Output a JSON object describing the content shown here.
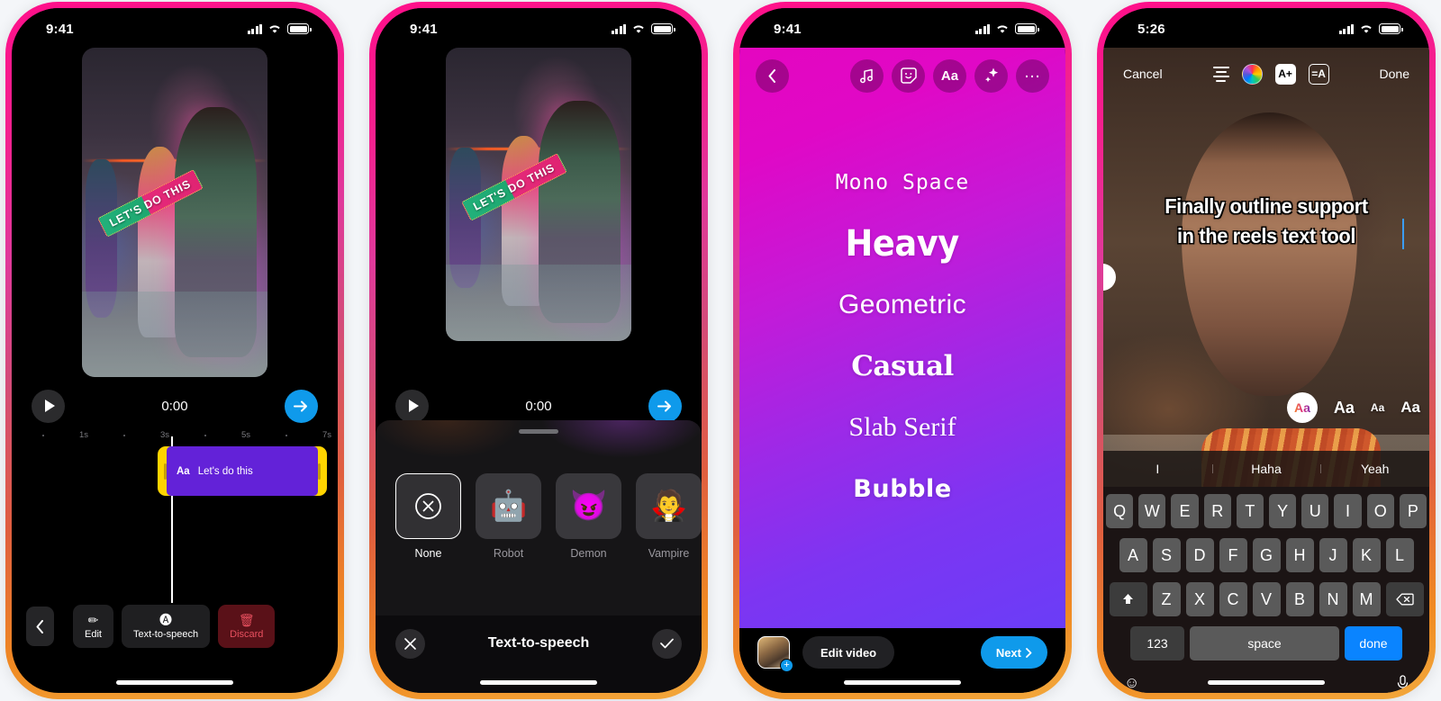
{
  "phone1": {
    "status": {
      "time": "9:41",
      "signal": "cellular-bars-icon",
      "wifi": "wifi-icon",
      "battery": "battery-full-icon"
    },
    "video": {
      "sticker_text": "LET'S DO THIS"
    },
    "transport": {
      "play": "play-icon",
      "time": "0:00",
      "next": "arrow-right-icon"
    },
    "ruler": {
      "ticks": [
        "1s",
        "3s",
        "5s",
        "7s"
      ]
    },
    "clip": {
      "icon_label": "Aa",
      "label": "Let's do this"
    },
    "bottom": {
      "back": "chevron-left-icon",
      "buttons": [
        {
          "name": "edit",
          "icon": "pencil-icon",
          "label": "Edit"
        },
        {
          "name": "text-to-speech",
          "icon": "speech-bubble-a-icon",
          "label": "Text-to-speech"
        },
        {
          "name": "discard",
          "icon": "trash-icon",
          "label": "Discard"
        }
      ]
    }
  },
  "phone2": {
    "status": {
      "time": "9:41"
    },
    "video": {
      "sticker_text": "LET'S DO THIS"
    },
    "transport": {
      "time": "0:00"
    },
    "sheet": {
      "title": "Text-to-speech",
      "close": "close-icon",
      "confirm": "check-icon",
      "voices": [
        {
          "icon": "circle-x-icon",
          "label": "None",
          "selected": true
        },
        {
          "icon": "🤖",
          "label": "Robot",
          "selected": false
        },
        {
          "icon": "😈",
          "label": "Demon",
          "selected": false
        },
        {
          "icon": "🧛",
          "label": "Vampire",
          "selected": false
        }
      ]
    }
  },
  "phone3": {
    "status": {
      "time": "9:41"
    },
    "toolbar": [
      {
        "name": "back",
        "icon": "chevron-left-icon"
      },
      {
        "name": "music",
        "icon": "music-note-icon"
      },
      {
        "name": "sticker",
        "icon": "sticker-face-icon"
      },
      {
        "name": "text",
        "icon": "Aa"
      },
      {
        "name": "effects",
        "icon": "sparkles-icon"
      },
      {
        "name": "more",
        "icon": "ellipsis-icon"
      }
    ],
    "fonts": [
      {
        "label": "Mono Space",
        "style": "f-mono"
      },
      {
        "label": "Heavy",
        "style": "f-heavy"
      },
      {
        "label": "Geometric",
        "style": "f-geo"
      },
      {
        "label": "Casual",
        "style": "f-casual"
      },
      {
        "label": "Slab Serif",
        "style": "f-slab"
      },
      {
        "label": "Bubble",
        "style": "f-bubble"
      }
    ],
    "bottom": {
      "thumbnail": "video-thumbnail",
      "add_badge": "+",
      "edit_video": "Edit video",
      "next": "Next",
      "next_chevron": "chevron-right-icon"
    }
  },
  "phone4": {
    "status": {
      "time": "5:26"
    },
    "toolbar": {
      "cancel": "Cancel",
      "done": "Done",
      "align": "text-align-center-icon",
      "color": "color-wheel-icon",
      "style": "A+",
      "outline": "=A"
    },
    "caption": {
      "line1": "Finally outline support",
      "line2": "in the reels text tool"
    },
    "sizes": [
      {
        "label": "Aa",
        "selected": true
      },
      {
        "label": "Aa",
        "selected": false
      },
      {
        "label": "Aa",
        "selected": false
      },
      {
        "label": "Aa",
        "selected": false
      }
    ],
    "suggestions": [
      "I",
      "Haha",
      "Yeah"
    ],
    "keyboard": {
      "row1": [
        "Q",
        "W",
        "E",
        "R",
        "T",
        "Y",
        "U",
        "I",
        "O",
        "P"
      ],
      "row2": [
        "A",
        "S",
        "D",
        "F",
        "G",
        "H",
        "J",
        "K",
        "L"
      ],
      "row3_shift": "shift-icon",
      "row3": [
        "Z",
        "X",
        "C",
        "V",
        "B",
        "N",
        "M"
      ],
      "row3_delete": "backspace-icon",
      "numbers": "123",
      "space": "space",
      "done": "done",
      "emoji": "emoji-icon",
      "mic": "microphone-icon"
    }
  },
  "colors": {
    "frame_top": "#ff0f8a",
    "frame_bottom": "#f2a83c",
    "accent_blue": "#0f9aeb",
    "clip_yellow": "#ffd400",
    "clip_purple": "#6322d8",
    "background": "#f4f6f9"
  }
}
